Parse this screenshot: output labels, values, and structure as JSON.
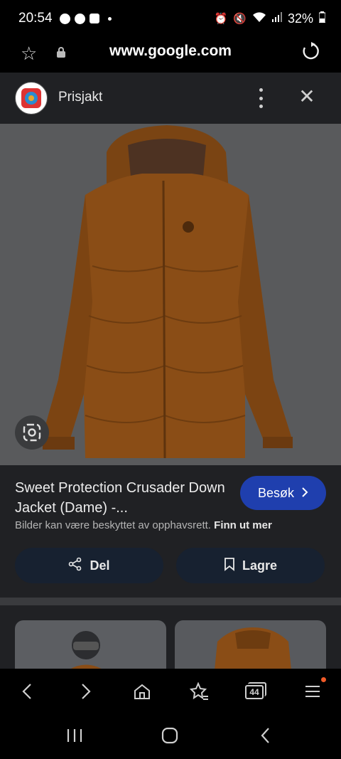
{
  "status_bar": {
    "time": "20:54",
    "battery": "32%"
  },
  "browser": {
    "url": "www.google.com",
    "icons": [
      "star-icon",
      "lock-icon",
      "reload-icon"
    ]
  },
  "sheet": {
    "source_name": "Prisjakt",
    "icons": [
      "more-vert-icon",
      "close-icon"
    ],
    "title": "Sweet Protection Crusader Down Jacket (Dame) -...",
    "visit_label": "Besøk",
    "copyright_text": "Bilder kan være beskyttet av opphavsrett.",
    "learn_more": "Finn ut mer",
    "share_label": "Del",
    "save_label": "Lagre",
    "image": {
      "subject": "jacket-image",
      "colors": {
        "jacket": "#8a4d16",
        "background": "#595a5c"
      }
    }
  },
  "bottom_nav": {
    "tab_count": "44",
    "items": [
      "back-icon",
      "forward-icon",
      "home-icon",
      "bookmark-star-icon",
      "tabs-icon",
      "menu-icon"
    ],
    "badge_color": "#f05a28"
  },
  "system_nav": {
    "items": [
      "recents-icon",
      "home-circle-icon",
      "back-icon"
    ]
  },
  "colors": {
    "sheet_bg": "#202124",
    "visit_button": "#1f3fae",
    "action_button": "#172130"
  }
}
